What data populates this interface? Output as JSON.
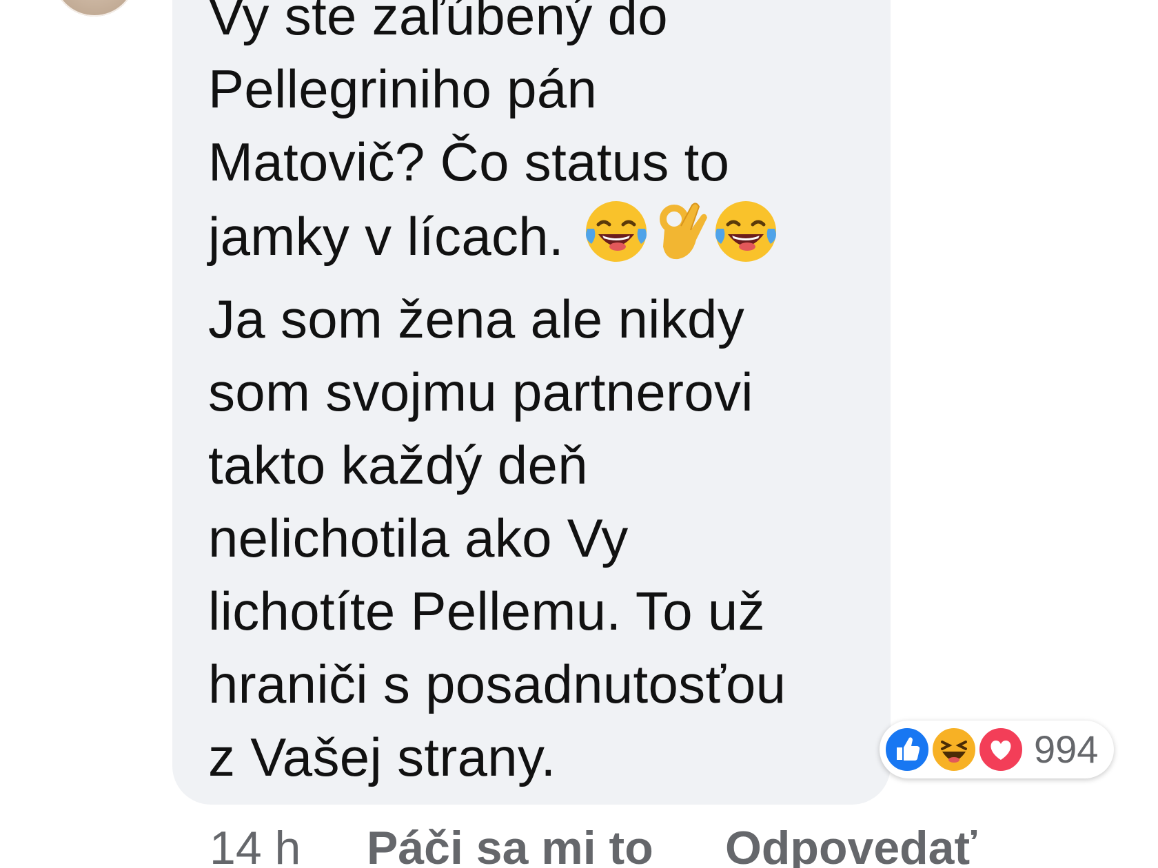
{
  "comment": {
    "lines": [
      "Vy ste zaľúbený do",
      "Pellegriniho pán",
      "Matovič? Čo status to",
      "jamky v lícach.",
      "Ja som žena ale nikdy",
      "som svojmu partnerovi",
      "takto každý deň",
      "nelichotila ako Vy",
      "lichotíte Pellemu. To už",
      "hraniči s posadnutosťou",
      "z Vašej strany."
    ],
    "inline_emojis": [
      "tears-of-joy-emoji",
      "ok-hand-emoji",
      "tears-of-joy-emoji"
    ],
    "bubble_color": "#f0f2f5"
  },
  "reactions": {
    "icons": [
      "like-icon",
      "haha-icon",
      "love-icon"
    ],
    "count": "994",
    "colors": {
      "like": "#1877f2",
      "haha": "#f7b125",
      "love": "#f33e58"
    }
  },
  "actions": {
    "time": "14 h",
    "like_label": "Páči sa mi to",
    "reply_label": "Odpovedať"
  },
  "colors": {
    "text": "#111111",
    "meta": "#65676b"
  }
}
